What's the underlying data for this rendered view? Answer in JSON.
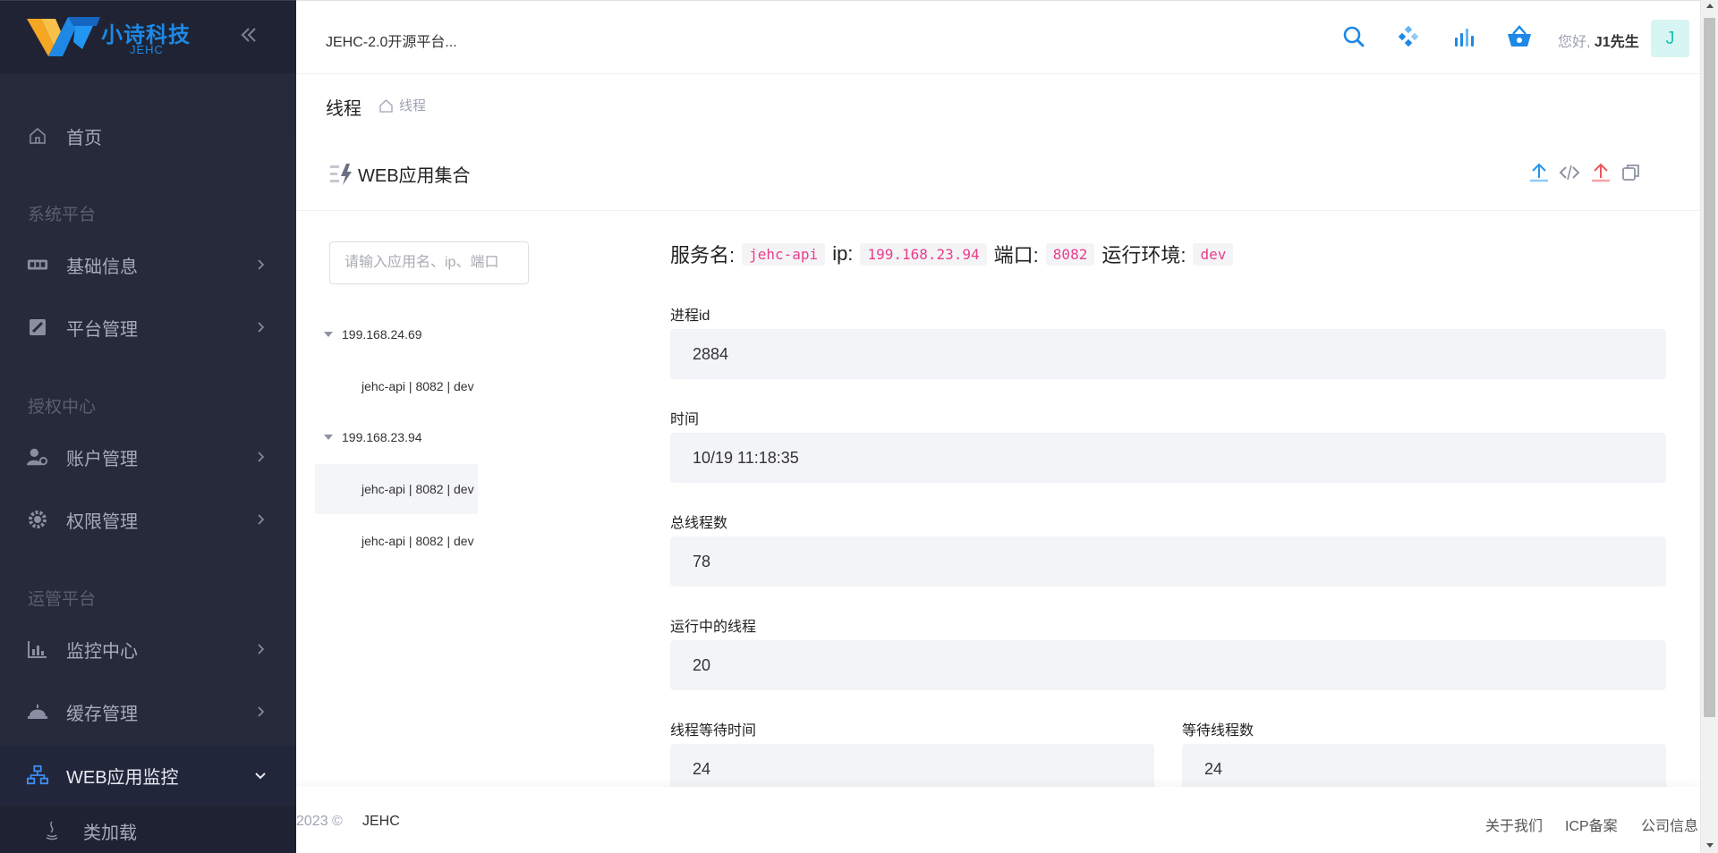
{
  "brand": {
    "name": "小诗科技",
    "sub": "JEHC"
  },
  "header": {
    "app_title": "JEHC-2.0开源平台...",
    "greeting": "您好,",
    "user_name": "J1先生",
    "avatar_letter": "J"
  },
  "sidebar": {
    "home": "首页",
    "sections": [
      "系统平台",
      "授权中心",
      "运管平台"
    ],
    "items": [
      {
        "label": "基础信息",
        "icon": "id-card-icon"
      },
      {
        "label": "平台管理",
        "icon": "tools-icon"
      },
      {
        "label": "账户管理",
        "icon": "user-gear-icon"
      },
      {
        "label": "权限管理",
        "icon": "cog-icon"
      },
      {
        "label": "监控中心",
        "icon": "bar-chart-icon"
      },
      {
        "label": "缓存管理",
        "icon": "database-icon"
      },
      {
        "label": "WEB应用监控",
        "icon": "network-icon"
      }
    ],
    "sub_items": [
      {
        "label": "类加载",
        "icon": "java-icon"
      }
    ]
  },
  "page": {
    "title": "线程",
    "breadcrumb": "线程"
  },
  "card": {
    "title": "WEB应用集合"
  },
  "search": {
    "placeholder": "请输入应用名、ip、端口"
  },
  "tree": {
    "nodes": [
      {
        "ip": "199.168.24.69",
        "children": [
          "jehc-api | 8082 | dev"
        ]
      },
      {
        "ip": "199.168.23.94",
        "children": [
          "jehc-api | 8082 | dev",
          "jehc-api | 8082 | dev"
        ]
      }
    ],
    "selected": "199.168.23.94 / 0"
  },
  "info": {
    "service_label": "服务名:",
    "service": "jehc-api",
    "ip_label": "ip:",
    "ip": "199.168.23.94",
    "port_label": "端口:",
    "port": "8082",
    "env_label": "运行环境:",
    "env": "dev"
  },
  "fields": {
    "pid": {
      "label": "进程id",
      "value": "2884"
    },
    "time": {
      "label": "时间",
      "value": "10/19 11:18:35"
    },
    "total_threads": {
      "label": "总线程数",
      "value": "78"
    },
    "running_threads": {
      "label": "运行中的线程",
      "value": "20"
    },
    "thread_wait_time": {
      "label": "线程等待时间",
      "value": "24"
    },
    "waiting_threads": {
      "label": "等待线程数",
      "value": "24"
    }
  },
  "footer": {
    "copyright": "2023 ©",
    "brand": "JEHC",
    "links": [
      "关于我们",
      "ICP备案",
      "公司信息"
    ]
  },
  "colors": {
    "sidebar_bg": "#262a3b",
    "accent_blue": "#1e88e5",
    "code_pink": "#e83e8c",
    "upload_red": "#f25461",
    "avatar_bg": "#d7f5f3"
  }
}
